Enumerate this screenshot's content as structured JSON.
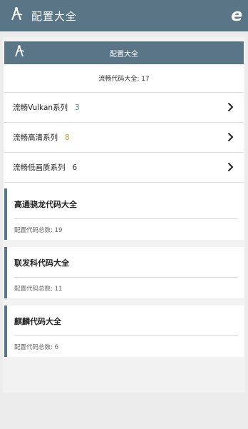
{
  "app": {
    "title": "配置大全",
    "browser_icon": "ie-browser-icon"
  },
  "subheader": {
    "title": "配置大全"
  },
  "summary": {
    "total_label": "流畅代码大全: 17"
  },
  "series": [
    {
      "label": "流畅Vulkan系列",
      "count": "3"
    },
    {
      "label": "流畅高清系列",
      "count": "8"
    },
    {
      "label": "流畅低画质系列",
      "count": "6"
    }
  ],
  "vendors": [
    {
      "title": "高通骁龙代码大全",
      "count_label": "配置代码总数: 19"
    },
    {
      "title": "联发科代码大全",
      "count_label": "配置代码总数: 11"
    },
    {
      "title": "麒麟代码大全",
      "count_label": "配置代码总数: 6"
    }
  ],
  "colors": {
    "header": "#5a7686",
    "background": "#ececec",
    "card": "#ffffff",
    "count_accent": "#5a7686"
  }
}
